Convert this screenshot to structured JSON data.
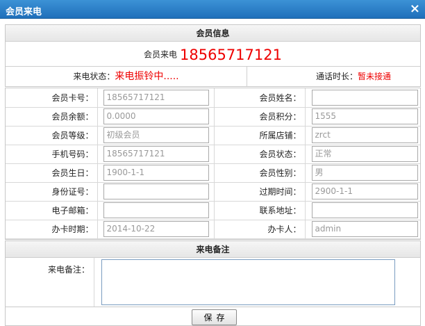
{
  "window": {
    "title": "会员来电",
    "close_icon": "×"
  },
  "member_info": {
    "heading": "会员信息",
    "caller_label": "会员来电",
    "caller_number": "18565717121",
    "status_label": "来电状态：",
    "status_value": "来电振铃中.....",
    "duration_label": "通话时长：",
    "duration_value": "暂未接通"
  },
  "fields": [
    {
      "label": "会员卡号：",
      "value": "18565717121",
      "label2": "会员姓名：",
      "value2": ""
    },
    {
      "label": "会员余额：",
      "value": "0.0000",
      "label2": "会员积分：",
      "value2": "1555"
    },
    {
      "label": "会员等级：",
      "value": "初级会员",
      "label2": "所属店铺：",
      "value2": "zrct"
    },
    {
      "label": "手机号码：",
      "value": "18565717121",
      "label2": "会员状态：",
      "value2": "正常"
    },
    {
      "label": "会员生日：",
      "value": "1900-1-1",
      "label2": "会员性别：",
      "value2": "男"
    },
    {
      "label": "身份证号：",
      "value": "",
      "label2": "过期时间：",
      "value2": "2900-1-1"
    },
    {
      "label": "电子邮箱：",
      "value": "",
      "label2": "联系地址：",
      "value2": ""
    },
    {
      "label": "办卡时期：",
      "value": "2014-10-22",
      "label2": "办卡人：",
      "value2": "admin"
    }
  ],
  "remark": {
    "heading": "来电备注",
    "label": "来电备注：",
    "value": ""
  },
  "actions": {
    "save_label": "保存"
  }
}
